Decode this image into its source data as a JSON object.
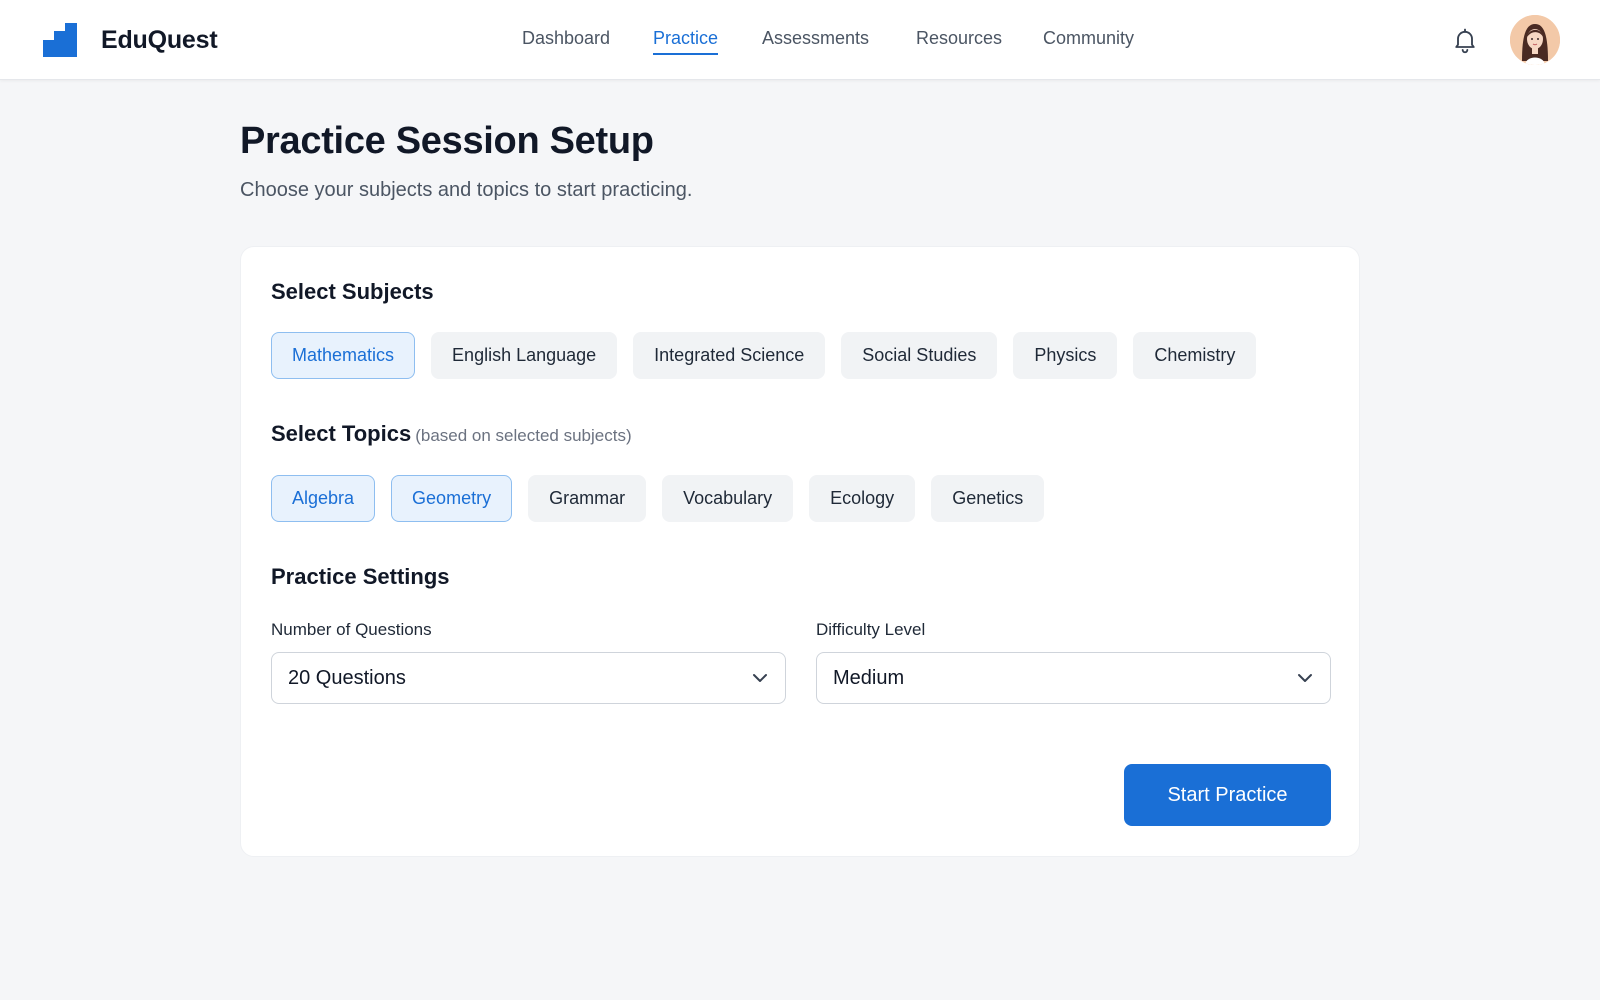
{
  "app": {
    "name": "EduQuest"
  },
  "nav": {
    "links": [
      {
        "label": "Dashboard",
        "active": false
      },
      {
        "label": "Practice",
        "active": true
      },
      {
        "label": "Assessments",
        "active": false
      },
      {
        "label": "Resources",
        "active": false
      },
      {
        "label": "Community",
        "active": false
      }
    ],
    "icons": {
      "notifications": "bell-icon",
      "profile": "avatar"
    }
  },
  "page": {
    "title": "Practice Session Setup",
    "subtitle": "Choose your subjects and topics to start practicing."
  },
  "subjects": {
    "title": "Select Subjects",
    "items": [
      {
        "label": "Mathematics",
        "selected": true
      },
      {
        "label": "English Language",
        "selected": false
      },
      {
        "label": "Integrated Science",
        "selected": false
      },
      {
        "label": "Social Studies",
        "selected": false
      },
      {
        "label": "Physics",
        "selected": false
      },
      {
        "label": "Chemistry",
        "selected": false
      }
    ]
  },
  "topics": {
    "title": "Select Topics",
    "note": "(based on selected subjects)",
    "items": [
      {
        "label": "Algebra",
        "selected": true
      },
      {
        "label": "Geometry",
        "selected": true
      },
      {
        "label": "Grammar",
        "selected": false
      },
      {
        "label": "Vocabulary",
        "selected": false
      },
      {
        "label": "Ecology",
        "selected": false
      },
      {
        "label": "Genetics",
        "selected": false
      }
    ]
  },
  "settings": {
    "title": "Practice Settings",
    "questions": {
      "label": "Number of Questions",
      "value": "20 Questions"
    },
    "difficulty": {
      "label": "Difficulty Level",
      "value": "Medium"
    }
  },
  "actions": {
    "start_label": "Start Practice"
  },
  "colors": {
    "accent": "#1a6fd6",
    "selected_bg": "#e8f2fd",
    "chip_bg": "#f1f3f5",
    "page_bg": "#f5f6f8"
  }
}
